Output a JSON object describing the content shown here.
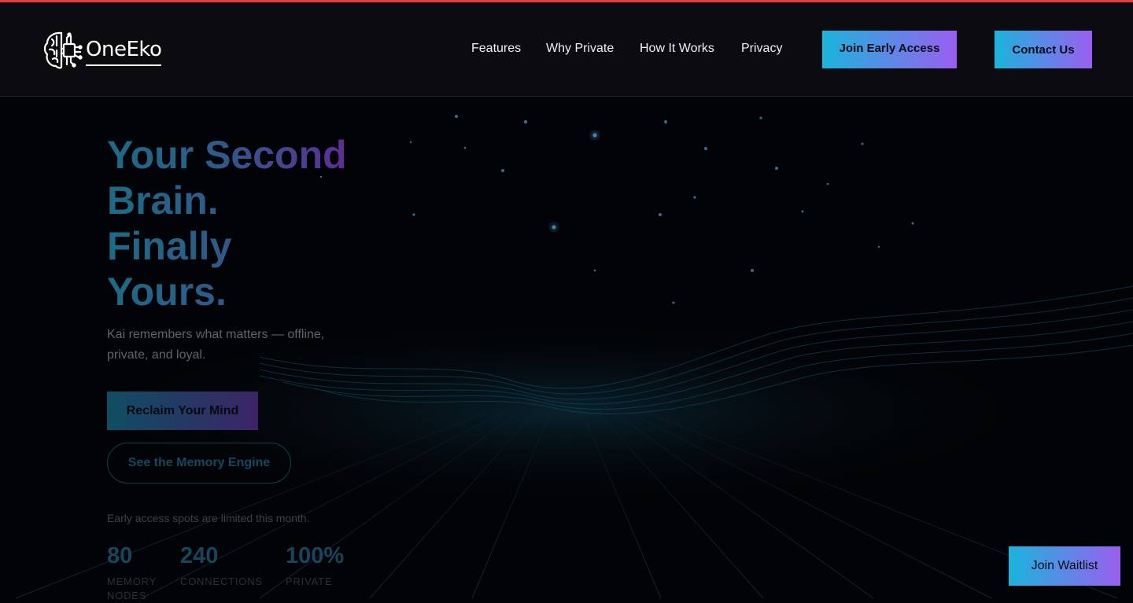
{
  "brand": {
    "name": "OneEko",
    "logo_icon": "brain-circuit-icon"
  },
  "nav": {
    "links": [
      {
        "label": "Features"
      },
      {
        "label": "Why Private"
      },
      {
        "label": "How It Works"
      },
      {
        "label": "Privacy"
      }
    ],
    "join_early_access": "Join Early Access",
    "contact_us": "Contact Us"
  },
  "hero": {
    "headline": [
      "Your Second",
      "Brain.",
      "Finally",
      "Yours."
    ],
    "subtitle": "Kai remembers what matters — offline, private, and loyal.",
    "primary_cta": "Reclaim Your Mind",
    "secondary_cta": "See the Memory Engine",
    "note": "Early access spots are limited this month.",
    "stats": [
      {
        "value": "80",
        "label": "MEMORY NODES"
      },
      {
        "value": "240",
        "label": "CONNECTIONS"
      },
      {
        "value": "100%",
        "label": "PRIVATE"
      }
    ]
  },
  "floating_cta": "Join Waitlist",
  "colors": {
    "accent_top_line": "#e93a3a",
    "gradient_start": "#1bb4dc",
    "gradient_end": "#9a5ff0",
    "header_bg": "#0b0b10",
    "page_bg": "#020306"
  }
}
